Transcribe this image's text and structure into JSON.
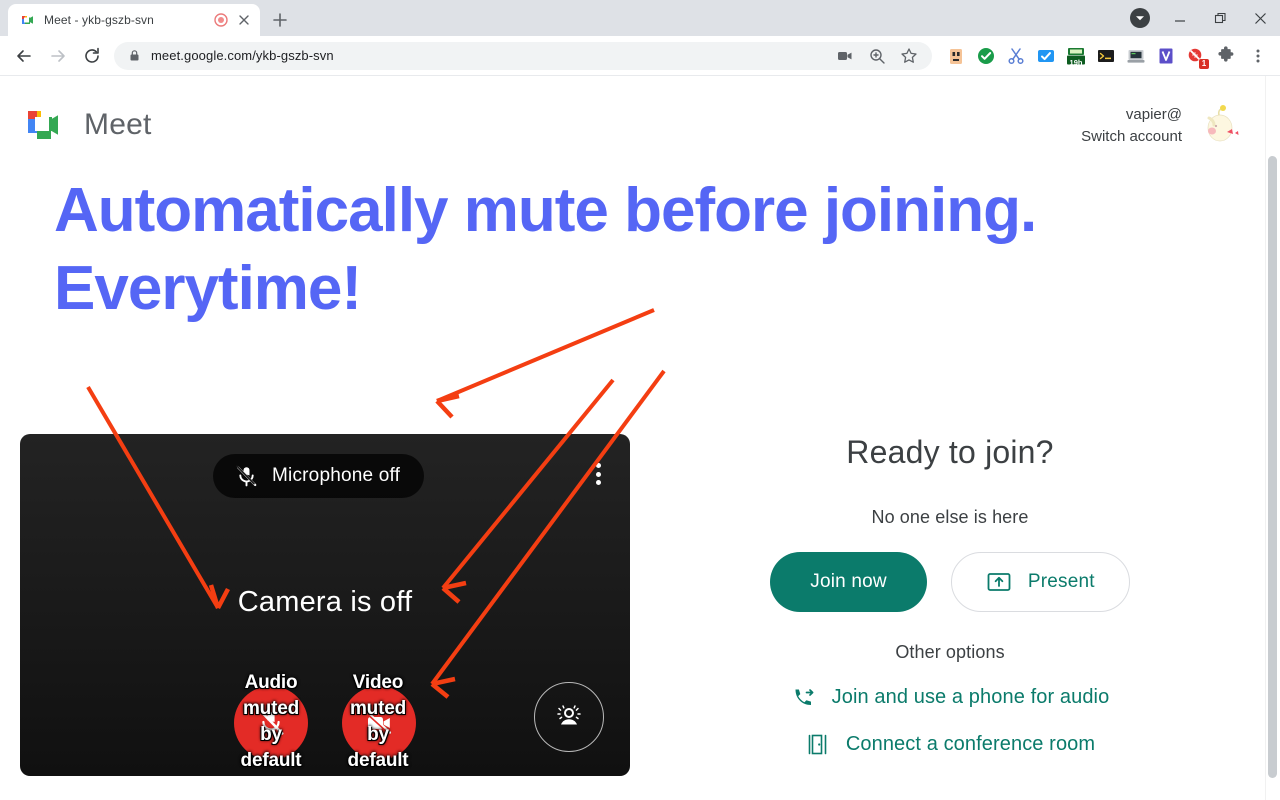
{
  "browser": {
    "tab": {
      "title": "Meet - ykb-gszb-svn",
      "favicon_icon": "meet-favicon-icon",
      "recording_icon": "recording-indicator-icon",
      "close_icon": "close-icon"
    },
    "new_tab_icon": "plus-icon",
    "window_controls": {
      "profile_icon": "profile-avatar-icon",
      "minimize_icon": "minimize-icon",
      "maximize_icon": "maximize-restore-icon",
      "close_icon": "window-close-icon"
    },
    "nav": {
      "back_icon": "back-arrow-icon",
      "forward_icon": "forward-arrow-icon",
      "reload_icon": "reload-icon"
    },
    "omnibox": {
      "lock_icon": "lock-icon",
      "url_domain": "meet.google.com",
      "url_path": "/ykb-gszb-svn",
      "full_url": "meet.google.com/ykb-gszb-svn",
      "media_icon": "video-camera-icon",
      "zoom_icon": "zoom-magnifier-icon",
      "bookmark_icon": "star-bookmark-icon"
    },
    "extensions": [
      {
        "name": "extension-1-icon",
        "label": ""
      },
      {
        "name": "extension-adblock-icon",
        "label": ""
      },
      {
        "name": "extension-scissors-icon",
        "label": ""
      },
      {
        "name": "extension-checkmark-icon",
        "label": ""
      },
      {
        "name": "extension-timer-icon",
        "label": "19h"
      },
      {
        "name": "extension-terminal-icon",
        "label": ""
      },
      {
        "name": "extension-monitor-icon",
        "label": ""
      },
      {
        "name": "extension-v-icon",
        "label": "V"
      },
      {
        "name": "extension-blocker-icon",
        "label": "1"
      }
    ],
    "puzzle_icon": "extensions-puzzle-icon",
    "menu_icon": "chrome-menu-icon"
  },
  "meet": {
    "brand_name": "Meet",
    "brand_logo_icon": "google-meet-logo-icon",
    "account": {
      "email": "vapier@",
      "switch_label": "Switch account",
      "avatar_icon": "user-avatar-icon"
    },
    "headline": "Automatically mute before joining. Everytime!",
    "preview": {
      "mic_pill_label": "Microphone off",
      "mic_pill_icon": "microphone-off-icon",
      "kebab_icon": "more-options-icon",
      "camera_status": "Camera is off",
      "mic_button_icon": "microphone-off-icon",
      "camera_button_icon": "camera-off-icon",
      "effects_button_icon": "visual-effects-icon",
      "annotations": [
        {
          "name": "audio-annotation",
          "lines": [
            "Audio",
            "muted",
            "by",
            "default"
          ]
        },
        {
          "name": "video-annotation",
          "lines": [
            "Video",
            "muted",
            "by",
            "default"
          ]
        }
      ]
    },
    "join": {
      "title": "Ready to join?",
      "subtitle": "No one else is here",
      "join_button": "Join now",
      "present_button": "Present",
      "present_icon": "present-screen-icon",
      "other_options_label": "Other options",
      "options": [
        {
          "label": "Join and use a phone for audio",
          "icon": "phone-forward-icon"
        },
        {
          "label": "Connect a conference room",
          "icon": "conference-room-icon"
        }
      ]
    }
  },
  "colors": {
    "headline_blue": "#5566f5",
    "join_teal": "#0b7b6b",
    "annotation_red": "#f43e12",
    "mute_circle_red": "#e32b26"
  }
}
